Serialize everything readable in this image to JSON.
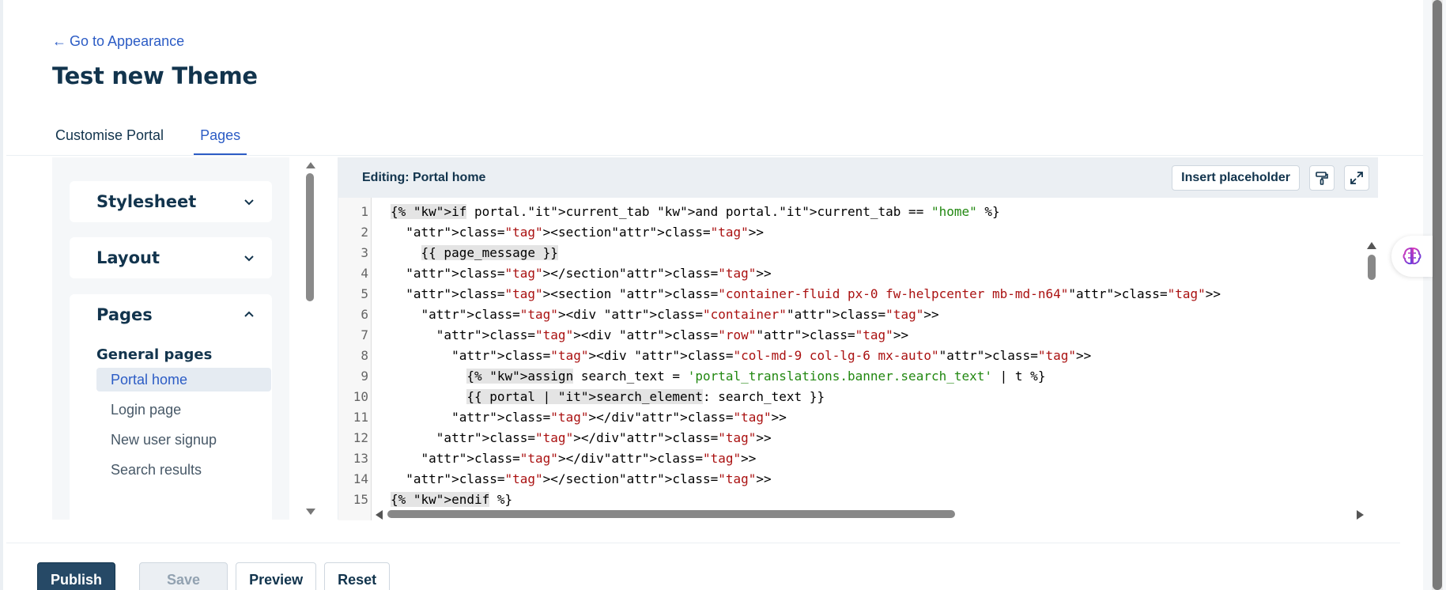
{
  "header": {
    "back_link": "Go to Appearance",
    "title": "Test new Theme"
  },
  "tabs": [
    {
      "label": "Customise Portal",
      "active": false
    },
    {
      "label": "Pages",
      "active": true
    }
  ],
  "sidebar": {
    "sections": [
      {
        "label": "Stylesheet",
        "expanded": false
      },
      {
        "label": "Layout",
        "expanded": false
      },
      {
        "label": "Pages",
        "expanded": true
      }
    ],
    "group_label": "General pages",
    "pages": [
      {
        "label": "Portal home",
        "active": true
      },
      {
        "label": "Login page",
        "active": false
      },
      {
        "label": "New user signup",
        "active": false
      },
      {
        "label": "Search results",
        "active": false
      }
    ]
  },
  "editor": {
    "title": "Editing: Portal home",
    "insert_placeholder_label": "Insert placeholder",
    "format_icon": "paint-roller-icon",
    "expand_icon": "expand-icon",
    "line_numbers": [
      "1",
      "2",
      "3",
      "4",
      "5",
      "6",
      "7",
      "8",
      "9",
      "10",
      "11",
      "12",
      "13",
      "14",
      "15"
    ],
    "code_lines": [
      "{% if portal.current_tab and portal.current_tab == \"home\" %}",
      "  <section>",
      "    {{ page_message }}",
      "  </section>",
      "  <section class=\"container-fluid px-0 fw-helpcenter mb-md-n64\">",
      "    <div class=\"container\">",
      "      <div class=\"row\">",
      "        <div class=\"col-md-9 col-lg-6 mx-auto\">",
      "          {% assign search_text = 'portal_translations.banner.search_text' | t %}",
      "          {{ portal | search_element: search_text }}",
      "        </div>",
      "      </div>",
      "    </div>",
      "  </section>",
      "{% endif %}"
    ]
  },
  "footer": {
    "publish": "Publish",
    "save": "Save",
    "preview": "Preview",
    "reset": "Reset"
  },
  "colors": {
    "primary": "#264966",
    "link": "#2c5cc5",
    "text": "#12344d",
    "panel_bg": "#f5f7f9",
    "editor_header_bg": "#ebeff3",
    "code_tag": "#117700",
    "code_attr": "#0000cc",
    "code_string": "#aa1111"
  }
}
